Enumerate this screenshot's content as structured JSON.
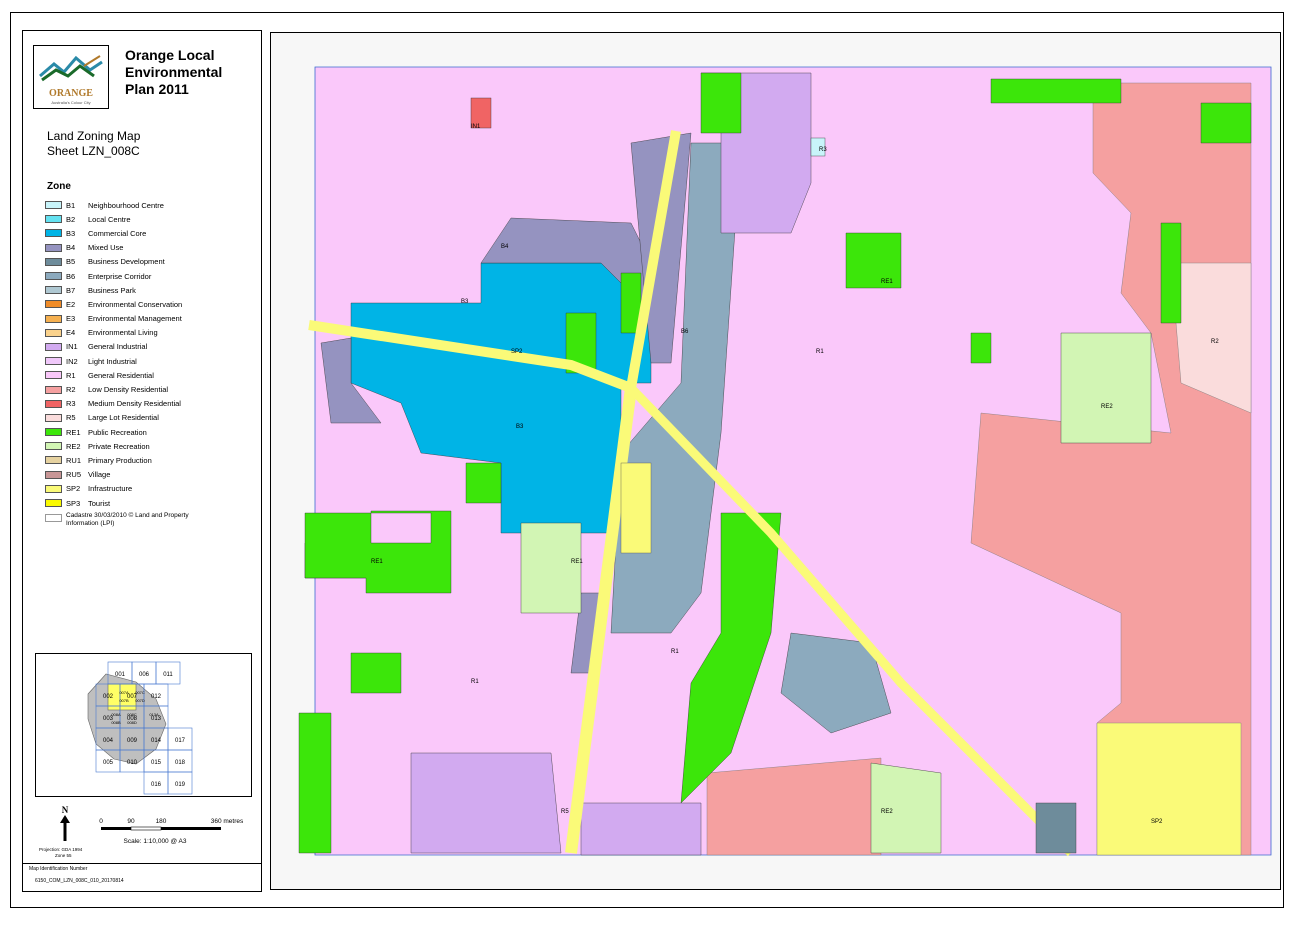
{
  "title": {
    "line1": "Orange Local",
    "line2": "Environmental",
    "line3": "Plan 2011"
  },
  "logo": {
    "text": "ORANGE",
    "subtext": "Australia's Colour City"
  },
  "map_subtitle": {
    "line1": "Land Zoning Map",
    "line2": "Sheet LZN_008C"
  },
  "zone_heading": "Zone",
  "zones": [
    {
      "code": "B1",
      "name": "Neighbourhood Centre",
      "color": "#c8f4fa"
    },
    {
      "code": "B2",
      "name": "Local Centre",
      "color": "#64e1f0"
    },
    {
      "code": "B3",
      "name": "Commercial Core",
      "color": "#00b4e6"
    },
    {
      "code": "B4",
      "name": "Mixed Use",
      "color": "#9593c0"
    },
    {
      "code": "B5",
      "name": "Business Development",
      "color": "#6e8c9b"
    },
    {
      "code": "B6",
      "name": "Enterprise Corridor",
      "color": "#8caabe"
    },
    {
      "code": "B7",
      "name": "Business Park",
      "color": "#afc8d2"
    },
    {
      "code": "E2",
      "name": "Environmental Conservation",
      "color": "#f08c28"
    },
    {
      "code": "E3",
      "name": "Environmental Management",
      "color": "#f5b050"
    },
    {
      "code": "E4",
      "name": "Environmental Living",
      "color": "#fad28c"
    },
    {
      "code": "IN1",
      "name": "General Industrial",
      "color": "#d2aaf0"
    },
    {
      "code": "IN2",
      "name": "Light Industrial",
      "color": "#f0c8fa"
    },
    {
      "code": "R1",
      "name": "General Residential",
      "color": "#fac8fa"
    },
    {
      "code": "R2",
      "name": "Low Density Residential",
      "color": "#f5a0a0"
    },
    {
      "code": "R3",
      "name": "Medium Density Residential",
      "color": "#f06464"
    },
    {
      "code": "R5",
      "name": "Large Lot Residential",
      "color": "#fadcdc"
    },
    {
      "code": "RE1",
      "name": "Public Recreation",
      "color": "#3ce60a"
    },
    {
      "code": "RE2",
      "name": "Private Recreation",
      "color": "#d2f5b4"
    },
    {
      "code": "RU1",
      "name": "Primary Production",
      "color": "#e6d2a0"
    },
    {
      "code": "RU5",
      "name": "Village",
      "color": "#c89696"
    },
    {
      "code": "SP2",
      "name": "Infrastructure",
      "color": "#fafa78"
    },
    {
      "code": "SP3",
      "name": "Tourist",
      "color": "#fafa00"
    }
  ],
  "cadastre": {
    "line1": "Cadastre 30/03/2010 © Land and Property",
    "line2": "Information (LPI)"
  },
  "index_map": {
    "sheets": [
      "001",
      "006",
      "011",
      "002",
      "007",
      "012",
      "003",
      "008",
      "013",
      "004",
      "009",
      "014",
      "017",
      "005",
      "010",
      "015",
      "018",
      "016",
      "019"
    ],
    "subsheets": [
      "007A",
      "007C",
      "007B",
      "007D",
      "008A",
      "008C",
      "008B",
      "008D",
      "013A"
    ]
  },
  "scale": {
    "north": "N",
    "ticks": [
      "0",
      "90",
      "180",
      "360 metres"
    ],
    "label": "Scale: 1:10,000 @ A3",
    "projection1": "Projection: GDA 1994",
    "projection2": "Zone 55"
  },
  "footer": {
    "label": "Map Identification Number",
    "id": "6150_COM_LZN_008C_010_20170814"
  },
  "map_labels": [
    "R1",
    "B3",
    "B4",
    "B6",
    "SP2",
    "RE1",
    "RE2",
    "R2",
    "R5",
    "IN1",
    "R3",
    "B1"
  ]
}
